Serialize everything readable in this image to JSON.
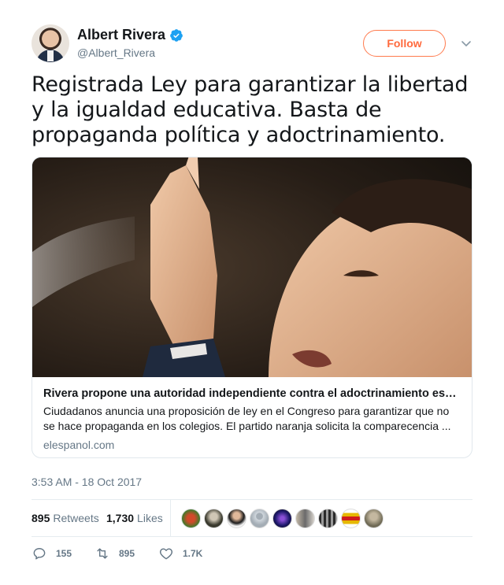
{
  "author": {
    "name": "Albert Rivera",
    "handle": "@Albert_Rivera",
    "verified": true,
    "avatar_icon": "profile-photo"
  },
  "follow_label": "Follow",
  "tweet_text": "Registrada Ley para garantizar la libertad y la igualdad educativa. Basta de propaganda política y adoctrinamiento.",
  "card": {
    "title": "Rivera propone una autoridad independiente contra el adoctrinamiento escol...",
    "description": "Ciudadanos anuncia una proposición de ley en el Congreso para garantizar que no se hace propaganda en los colegios. El partido naranja solicita la comparecencia ...",
    "domain": "elespanol.com"
  },
  "timestamp": "3:53 AM - 18 Oct 2017",
  "stats": {
    "retweets_count": "895",
    "retweets_label": "Retweets",
    "likes_count": "1,730",
    "likes_label": "Likes"
  },
  "actions": {
    "replies": "155",
    "retweets": "895",
    "likes": "1.7K"
  },
  "colors": {
    "accent": "#ff6a3d",
    "verified": "#1da1f2",
    "muted": "#657786",
    "text": "#14171a"
  }
}
